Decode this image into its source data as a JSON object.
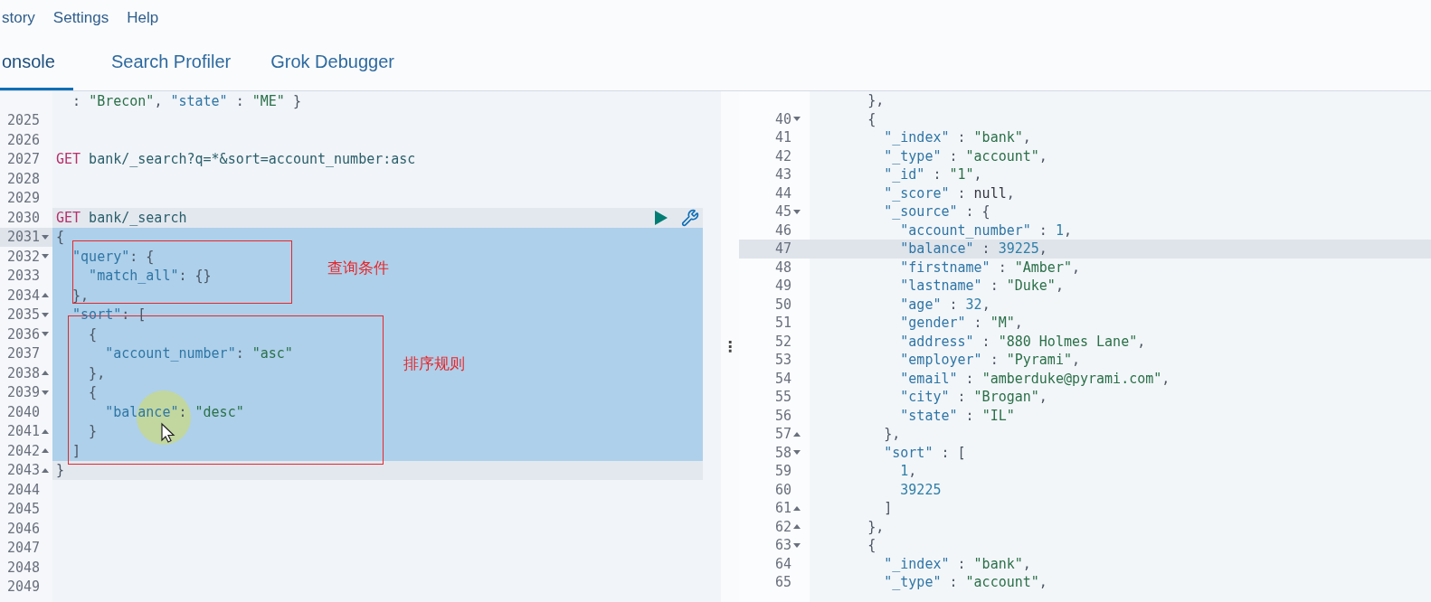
{
  "menu": [
    {
      "label": "story"
    },
    {
      "label": "Settings"
    },
    {
      "label": "Help"
    }
  ],
  "tabs": [
    {
      "label": "onsole",
      "selected": true
    },
    {
      "label": "Search Profiler",
      "selected": false
    },
    {
      "label": "Grok Debugger",
      "selected": false
    }
  ],
  "request_editor": {
    "lines": [
      {
        "fold_start": false,
        "fold_end": false,
        "selected": false,
        "in_request": false,
        "active": false,
        "actions": false,
        "tokens": [
          {
            "kind": "punct",
            "text": "  : "
          },
          {
            "kind": "string",
            "text": "\"Brecon\""
          },
          {
            "kind": "punct",
            "text": ", "
          },
          {
            "kind": "key",
            "text": "\"state\""
          },
          {
            "kind": "punct",
            "text": " : "
          },
          {
            "kind": "string",
            "text": "\"ME\""
          },
          {
            "kind": "punct",
            "text": " }"
          }
        ]
      },
      {
        "n": "2025",
        "fold_start": false,
        "fold_end": false,
        "selected": false,
        "in_request": false,
        "active": false,
        "actions": false
      },
      {
        "n": "2026",
        "fold_start": false,
        "fold_end": false,
        "selected": false,
        "in_request": false,
        "active": false,
        "actions": false
      },
      {
        "n": "2027",
        "fold_start": false,
        "fold_end": false,
        "selected": false,
        "in_request": false,
        "active": false,
        "actions": false,
        "tokens": [
          {
            "kind": "method",
            "text": "GET"
          },
          {
            "kind": "path",
            "text": " bank/_search?q=*&sort=account_number:asc"
          }
        ]
      },
      {
        "n": "2028",
        "fold_start": false,
        "fold_end": false,
        "selected": false,
        "in_request": false,
        "active": false,
        "actions": false
      },
      {
        "n": "2029",
        "fold_start": false,
        "fold_end": false,
        "selected": false,
        "in_request": false,
        "active": false,
        "actions": false
      },
      {
        "n": "2030",
        "fold_start": false,
        "fold_end": false,
        "selected": false,
        "in_request": true,
        "active": false,
        "actions": true,
        "tokens": [
          {
            "kind": "method",
            "text": "GET"
          },
          {
            "kind": "path",
            "text": " bank/_search"
          }
        ]
      },
      {
        "n": "2031",
        "fold_start": true,
        "fold_end": false,
        "selected": true,
        "in_request": true,
        "active": true,
        "actions": false,
        "tokens": [
          {
            "kind": "punct",
            "text": "{"
          }
        ]
      },
      {
        "n": "2032",
        "fold_start": true,
        "fold_end": false,
        "selected": true,
        "in_request": true,
        "active": false,
        "actions": false,
        "tokens": [
          {
            "kind": "key",
            "text": "  \"query\""
          },
          {
            "kind": "punct",
            "text": ": {"
          }
        ]
      },
      {
        "n": "2033",
        "fold_start": false,
        "fold_end": false,
        "selected": true,
        "in_request": true,
        "active": false,
        "actions": false,
        "tokens": [
          {
            "kind": "key",
            "text": "    \"match_all\""
          },
          {
            "kind": "punct",
            "text": ": {}"
          }
        ]
      },
      {
        "n": "2034",
        "fold_start": false,
        "fold_end": true,
        "selected": true,
        "in_request": true,
        "active": false,
        "actions": false,
        "tokens": [
          {
            "kind": "punct",
            "text": "  },"
          }
        ]
      },
      {
        "n": "2035",
        "fold_start": true,
        "fold_end": false,
        "selected": true,
        "in_request": true,
        "active": false,
        "actions": false,
        "tokens": [
          {
            "kind": "key",
            "text": "  \"sort\""
          },
          {
            "kind": "punct",
            "text": ": ["
          }
        ]
      },
      {
        "n": "2036",
        "fold_start": true,
        "fold_end": false,
        "selected": true,
        "in_request": true,
        "active": false,
        "actions": false,
        "tokens": [
          {
            "kind": "punct",
            "text": "    {"
          }
        ]
      },
      {
        "n": "2037",
        "fold_start": false,
        "fold_end": false,
        "selected": true,
        "in_request": true,
        "active": false,
        "actions": false,
        "tokens": [
          {
            "kind": "key",
            "text": "      \"account_number\""
          },
          {
            "kind": "punct",
            "text": ": "
          },
          {
            "kind": "string",
            "text": "\"asc\""
          }
        ]
      },
      {
        "n": "2038",
        "fold_start": false,
        "fold_end": true,
        "selected": true,
        "in_request": true,
        "active": false,
        "actions": false,
        "tokens": [
          {
            "kind": "punct",
            "text": "    },"
          }
        ]
      },
      {
        "n": "2039",
        "fold_start": true,
        "fold_end": false,
        "selected": true,
        "in_request": true,
        "active": false,
        "actions": false,
        "tokens": [
          {
            "kind": "punct",
            "text": "    {"
          }
        ]
      },
      {
        "n": "2040",
        "fold_start": false,
        "fold_end": false,
        "selected": true,
        "in_request": true,
        "active": false,
        "actions": false,
        "tokens": [
          {
            "kind": "key",
            "text": "      \"balance\""
          },
          {
            "kind": "punct",
            "text": ": "
          },
          {
            "kind": "string",
            "text": "\"desc\""
          }
        ]
      },
      {
        "n": "2041",
        "fold_start": false,
        "fold_end": true,
        "selected": true,
        "in_request": true,
        "active": false,
        "actions": false,
        "tokens": [
          {
            "kind": "punct",
            "text": "    }"
          }
        ]
      },
      {
        "n": "2042",
        "fold_start": false,
        "fold_end": true,
        "selected": true,
        "in_request": true,
        "active": false,
        "actions": false,
        "tokens": [
          {
            "kind": "punct",
            "text": "  ]"
          }
        ]
      },
      {
        "n": "2043",
        "fold_start": false,
        "fold_end": true,
        "selected": false,
        "in_request": true,
        "active": false,
        "actions": false,
        "tokens": [
          {
            "kind": "punct",
            "text": "}"
          }
        ]
      },
      {
        "n": "2044",
        "fold_start": false,
        "fold_end": false,
        "selected": false,
        "in_request": false,
        "active": false,
        "actions": false
      },
      {
        "n": "2045",
        "fold_start": false,
        "fold_end": false,
        "selected": false,
        "in_request": false,
        "active": false,
        "actions": false
      },
      {
        "n": "2046",
        "fold_start": false,
        "fold_end": false,
        "selected": false,
        "in_request": false,
        "active": false,
        "actions": false
      },
      {
        "n": "2047",
        "fold_start": false,
        "fold_end": false,
        "selected": false,
        "in_request": false,
        "active": false,
        "actions": false
      },
      {
        "n": "2048",
        "fold_start": false,
        "fold_end": false,
        "selected": false,
        "in_request": false,
        "active": false,
        "actions": false
      },
      {
        "n": "2049",
        "fold_start": false,
        "fold_end": false,
        "selected": false,
        "in_request": false,
        "active": false,
        "actions": false
      }
    ]
  },
  "annotations": [
    {
      "text": "查询条件"
    },
    {
      "text": "排序规则"
    }
  ],
  "divider_handle": "⋮",
  "response_viewer": {
    "lines": [
      {
        "fold_start": false,
        "fold_end": false,
        "selected": false,
        "tokens": [
          {
            "kind": "punct",
            "text": "      },"
          }
        ]
      },
      {
        "n": "40",
        "fold_start": true,
        "fold_end": false,
        "selected": false,
        "tokens": [
          {
            "kind": "punct",
            "text": "      {"
          }
        ]
      },
      {
        "n": "41",
        "fold_start": false,
        "fold_end": false,
        "selected": false,
        "tokens": [
          {
            "kind": "key",
            "text": "        \"_index\""
          },
          {
            "kind": "punct",
            "text": " : "
          },
          {
            "kind": "string",
            "text": "\"bank\""
          },
          {
            "kind": "punct",
            "text": ","
          }
        ]
      },
      {
        "n": "42",
        "fold_start": false,
        "fold_end": false,
        "selected": false,
        "tokens": [
          {
            "kind": "key",
            "text": "        \"_type\""
          },
          {
            "kind": "punct",
            "text": " : "
          },
          {
            "kind": "string",
            "text": "\"account\""
          },
          {
            "kind": "punct",
            "text": ","
          }
        ]
      },
      {
        "n": "43",
        "fold_start": false,
        "fold_end": false,
        "selected": false,
        "tokens": [
          {
            "kind": "key",
            "text": "        \"_id\""
          },
          {
            "kind": "punct",
            "text": " : "
          },
          {
            "kind": "string",
            "text": "\"1\""
          },
          {
            "kind": "punct",
            "text": ","
          }
        ]
      },
      {
        "n": "44",
        "fold_start": false,
        "fold_end": false,
        "selected": false,
        "tokens": [
          {
            "kind": "key",
            "text": "        \"_score\""
          },
          {
            "kind": "punct",
            "text": " : "
          },
          {
            "kind": "plain",
            "text": "null"
          },
          {
            "kind": "punct",
            "text": ","
          }
        ]
      },
      {
        "n": "45",
        "fold_start": true,
        "fold_end": false,
        "selected": false,
        "tokens": [
          {
            "kind": "key",
            "text": "        \"_source\""
          },
          {
            "kind": "punct",
            "text": " : {"
          }
        ]
      },
      {
        "n": "46",
        "fold_start": false,
        "fold_end": false,
        "selected": false,
        "tokens": [
          {
            "kind": "key",
            "text": "          \"account_number\""
          },
          {
            "kind": "punct",
            "text": " : "
          },
          {
            "kind": "number",
            "text": "1"
          },
          {
            "kind": "punct",
            "text": ","
          }
        ]
      },
      {
        "n": "47",
        "fold_start": false,
        "fold_end": false,
        "selected": true,
        "tokens": [
          {
            "kind": "key",
            "text": "          \"balance\""
          },
          {
            "kind": "punct",
            "text": " : "
          },
          {
            "kind": "number",
            "text": "39225"
          },
          {
            "kind": "punct",
            "text": ","
          }
        ]
      },
      {
        "n": "48",
        "fold_start": false,
        "fold_end": false,
        "selected": false,
        "tokens": [
          {
            "kind": "key",
            "text": "          \"firstname\""
          },
          {
            "kind": "punct",
            "text": " : "
          },
          {
            "kind": "string",
            "text": "\"Amber\""
          },
          {
            "kind": "punct",
            "text": ","
          }
        ]
      },
      {
        "n": "49",
        "fold_start": false,
        "fold_end": false,
        "selected": false,
        "tokens": [
          {
            "kind": "key",
            "text": "          \"lastname\""
          },
          {
            "kind": "punct",
            "text": " : "
          },
          {
            "kind": "string",
            "text": "\"Duke\""
          },
          {
            "kind": "punct",
            "text": ","
          }
        ]
      },
      {
        "n": "50",
        "fold_start": false,
        "fold_end": false,
        "selected": false,
        "tokens": [
          {
            "kind": "key",
            "text": "          \"age\""
          },
          {
            "kind": "punct",
            "text": " : "
          },
          {
            "kind": "number",
            "text": "32"
          },
          {
            "kind": "punct",
            "text": ","
          }
        ]
      },
      {
        "n": "51",
        "fold_start": false,
        "fold_end": false,
        "selected": false,
        "tokens": [
          {
            "kind": "key",
            "text": "          \"gender\""
          },
          {
            "kind": "punct",
            "text": " : "
          },
          {
            "kind": "string",
            "text": "\"M\""
          },
          {
            "kind": "punct",
            "text": ","
          }
        ]
      },
      {
        "n": "52",
        "fold_start": false,
        "fold_end": false,
        "selected": false,
        "tokens": [
          {
            "kind": "key",
            "text": "          \"address\""
          },
          {
            "kind": "punct",
            "text": " : "
          },
          {
            "kind": "string",
            "text": "\"880 Holmes Lane\""
          },
          {
            "kind": "punct",
            "text": ","
          }
        ]
      },
      {
        "n": "53",
        "fold_start": false,
        "fold_end": false,
        "selected": false,
        "tokens": [
          {
            "kind": "key",
            "text": "          \"employer\""
          },
          {
            "kind": "punct",
            "text": " : "
          },
          {
            "kind": "string",
            "text": "\"Pyrami\""
          },
          {
            "kind": "punct",
            "text": ","
          }
        ]
      },
      {
        "n": "54",
        "fold_start": false,
        "fold_end": false,
        "selected": false,
        "tokens": [
          {
            "kind": "key",
            "text": "          \"email\""
          },
          {
            "kind": "punct",
            "text": " : "
          },
          {
            "kind": "string",
            "text": "\"amberduke@pyrami.com\""
          },
          {
            "kind": "punct",
            "text": ","
          }
        ]
      },
      {
        "n": "55",
        "fold_start": false,
        "fold_end": false,
        "selected": false,
        "tokens": [
          {
            "kind": "key",
            "text": "          \"city\""
          },
          {
            "kind": "punct",
            "text": " : "
          },
          {
            "kind": "string",
            "text": "\"Brogan\""
          },
          {
            "kind": "punct",
            "text": ","
          }
        ]
      },
      {
        "n": "56",
        "fold_start": false,
        "fold_end": false,
        "selected": false,
        "tokens": [
          {
            "kind": "key",
            "text": "          \"state\""
          },
          {
            "kind": "punct",
            "text": " : "
          },
          {
            "kind": "string",
            "text": "\"IL\""
          }
        ]
      },
      {
        "n": "57",
        "fold_start": false,
        "fold_end": true,
        "selected": false,
        "tokens": [
          {
            "kind": "punct",
            "text": "        },"
          }
        ]
      },
      {
        "n": "58",
        "fold_start": true,
        "fold_end": false,
        "selected": false,
        "tokens": [
          {
            "kind": "key",
            "text": "        \"sort\""
          },
          {
            "kind": "punct",
            "text": " : ["
          }
        ]
      },
      {
        "n": "59",
        "fold_start": false,
        "fold_end": false,
        "selected": false,
        "tokens": [
          {
            "kind": "number",
            "text": "          1"
          },
          {
            "kind": "punct",
            "text": ","
          }
        ]
      },
      {
        "n": "60",
        "fold_start": false,
        "fold_end": false,
        "selected": false,
        "tokens": [
          {
            "kind": "number",
            "text": "          39225"
          }
        ]
      },
      {
        "n": "61",
        "fold_start": false,
        "fold_end": true,
        "selected": false,
        "tokens": [
          {
            "kind": "punct",
            "text": "        ]"
          }
        ]
      },
      {
        "n": "62",
        "fold_start": false,
        "fold_end": true,
        "selected": false,
        "tokens": [
          {
            "kind": "punct",
            "text": "      },"
          }
        ]
      },
      {
        "n": "63",
        "fold_start": true,
        "fold_end": false,
        "selected": false,
        "tokens": [
          {
            "kind": "punct",
            "text": "      {"
          }
        ]
      },
      {
        "n": "64",
        "fold_start": false,
        "fold_end": false,
        "selected": false,
        "tokens": [
          {
            "kind": "key",
            "text": "        \"_index\""
          },
          {
            "kind": "punct",
            "text": " : "
          },
          {
            "kind": "string",
            "text": "\"bank\""
          },
          {
            "kind": "punct",
            "text": ","
          }
        ]
      },
      {
        "n": "65",
        "fold_start": false,
        "fold_end": false,
        "selected": false,
        "tokens": [
          {
            "kind": "key",
            "text": "        \"_type\""
          },
          {
            "kind": "punct",
            "text": " : "
          },
          {
            "kind": "string",
            "text": "\"account\""
          },
          {
            "kind": "punct",
            "text": ","
          }
        ]
      }
    ]
  }
}
